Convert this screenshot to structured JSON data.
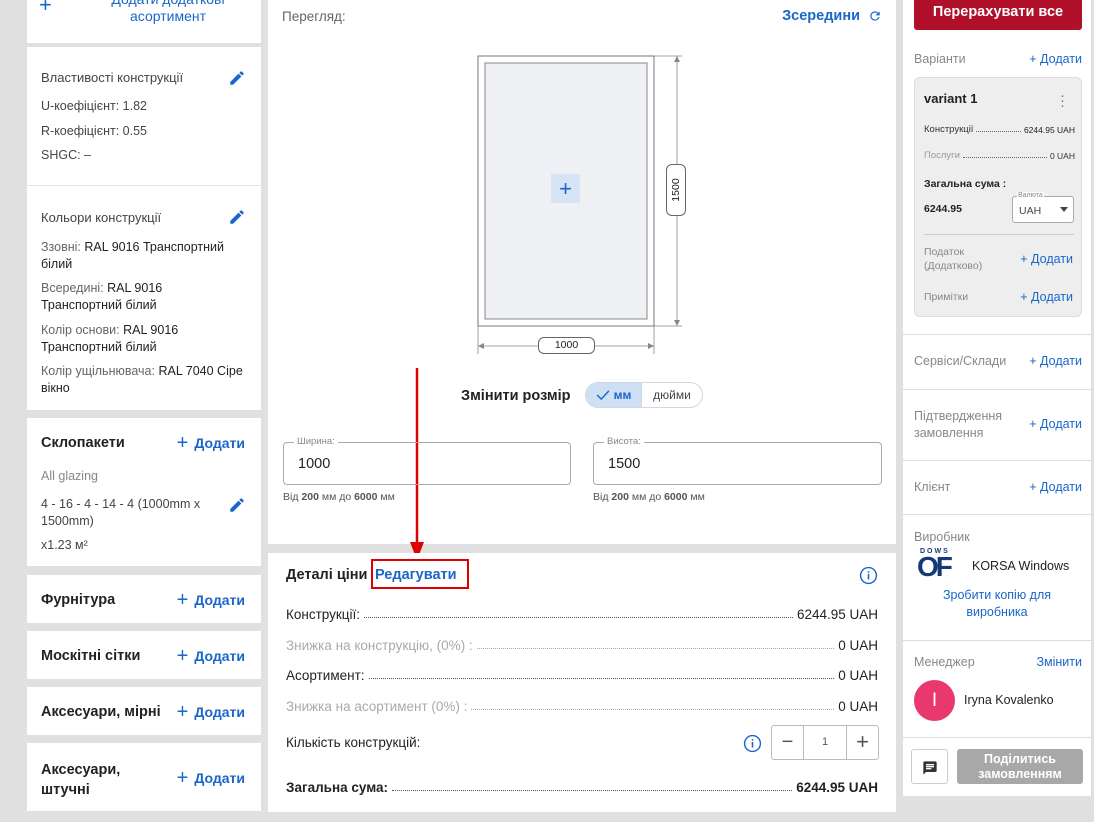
{
  "left": {
    "top_add_label_line1": "Додати додаткові",
    "top_add_label_line2": "асортимент",
    "properties": {
      "title": "Властивості конструкції",
      "u_coef": "U-коефіцієнт: 1.82",
      "r_coef": "R-коефіцієнт: 0.55",
      "shgc": "SHGC: –"
    },
    "colors": {
      "title": "Кольори конструкції",
      "outside_label": "Ззовні:",
      "outside_value": "RAL 9016 Транспортний білий",
      "inside_label": "Всередині:",
      "inside_value": "RAL 9016 Транспортний білий",
      "base_label": "Колір основи:",
      "base_value": "RAL 9016 Транспортний білий",
      "seal_label": "Колір ущільнювача:",
      "seal_value": "RAL 7040 Сіре вікно"
    },
    "glazing": {
      "title": "Склопакети",
      "add": "Додати",
      "subtitle": "All glazing",
      "spec": "4 - 16 - 4 - 14 - 4 (1000mm x 1500mm)",
      "qty": "x1.23 м²"
    },
    "sections": [
      {
        "title": "Фурнітура",
        "add": "Додати"
      },
      {
        "title": "Москітні сітки",
        "add": "Додати"
      },
      {
        "title": "Аксесуари, мірні",
        "add": "Додати"
      },
      {
        "title": "Аксесуари, штучні",
        "add": "Додати"
      }
    ]
  },
  "preview": {
    "title": "Перегляд:",
    "view_mode": "Зсередини",
    "dim_width": "1000",
    "dim_height": "1500",
    "resize_label": "Змінити розмір",
    "unit_mm": "мм",
    "unit_inch": "дюйми",
    "width_label": "Ширина:",
    "width_value": "1000",
    "height_label": "Висота:",
    "height_value": "1500",
    "width_hint_from": "Від",
    "width_hint_min": "200",
    "width_hint_mm1": "мм до",
    "width_hint_max": "6000",
    "width_hint_mm2": "мм",
    "height_hint_from": "Від",
    "height_hint_min": "200",
    "height_hint_mm1": "мм до",
    "height_hint_max": "6000",
    "height_hint_mm2": "мм"
  },
  "price": {
    "title": "Деталі ціни",
    "edit": "Редагувати",
    "rows": [
      {
        "label": "Конструкції:",
        "value": "6244.95 UAH"
      },
      {
        "label": "Знижка на конструкцію, (0%) :",
        "value": "0 UAH"
      },
      {
        "label": "Асортимент:",
        "value": "0 UAH"
      },
      {
        "label": "Знижка на асортимент (0%) :",
        "value": "0 UAH"
      }
    ],
    "quantity_label": "Кількість конструкцій:",
    "quantity_value": "1",
    "total_label": "Загальна сума:",
    "total_value": "6244.95 UAH"
  },
  "right": {
    "recalc_button": "Перерахувати все",
    "variants_label": "Варіанти",
    "variants_add": "+ Додати",
    "variant": {
      "name": "variant 1",
      "constructions_label": "Конструкції",
      "constructions_value": "6244.95 UAH",
      "services_label": "Послуги",
      "services_value": "0 UAH",
      "total_label": "Загальна сума :",
      "total_value": "6244.95",
      "currency_label": "Валюта",
      "currency_value": "UAH",
      "tax_label": "Податок (Додатково)",
      "tax_add": "+ Додати",
      "notes_label": "Примітки",
      "notes_add": "+ Додати"
    },
    "services_label": "Сервіси/Склади",
    "services_add": "+ Додати",
    "confirm_label": "Підтвердження замовлення",
    "confirm_add": "+ Додати",
    "client_label": "Клієнт",
    "client_add": "+ Додати",
    "producer_label": "Виробник",
    "producer_name": "KORSA Windows",
    "producer_logo_small": "DOWS",
    "producer_logo_big": "OF",
    "producer_copy": "Зробити копію для виробника",
    "manager_label": "Менеджер",
    "manager_change": "Змінити",
    "manager_initial": "I",
    "manager_name": "Iryna Kovalenko",
    "share_button": "Поділитись замовленням"
  },
  "colors": {
    "accent": "#1a66c9",
    "danger": "#b0102a",
    "highlight": "#e00000",
    "avatar": "#e8386e"
  }
}
